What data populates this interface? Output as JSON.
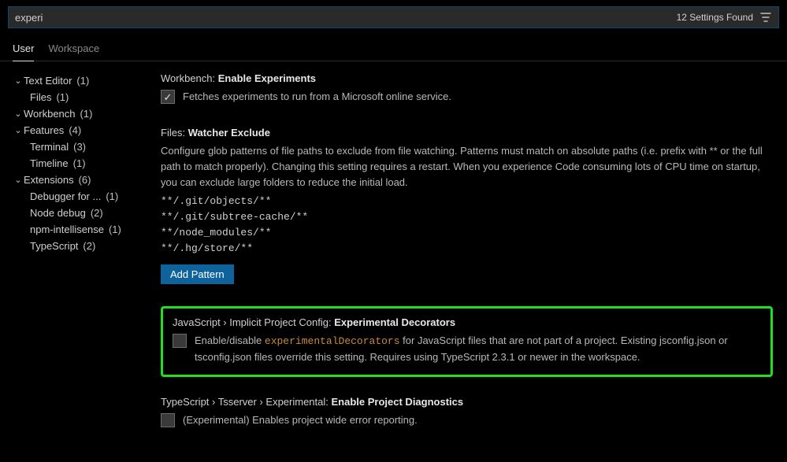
{
  "search": {
    "value": "experi",
    "status": "12 Settings Found"
  },
  "tabs": {
    "user": "User",
    "workspace": "Workspace"
  },
  "sidebar": {
    "items": [
      {
        "label": "Text Editor",
        "count": "(1)",
        "expanded": true,
        "children": [
          {
            "label": "Files",
            "count": "(1)"
          }
        ]
      },
      {
        "label": "Workbench",
        "count": "(1)",
        "expanded": true,
        "children": []
      },
      {
        "label": "Features",
        "count": "(4)",
        "expanded": true,
        "children": [
          {
            "label": "Terminal",
            "count": "(3)"
          },
          {
            "label": "Timeline",
            "count": "(1)"
          }
        ]
      },
      {
        "label": "Extensions",
        "count": "(6)",
        "expanded": true,
        "children": [
          {
            "label": "Debugger for ...",
            "count": "(1)"
          },
          {
            "label": "Node debug",
            "count": "(2)"
          },
          {
            "label": "npm-intellisense",
            "count": "(1)"
          },
          {
            "label": "TypeScript",
            "count": "(2)"
          }
        ]
      }
    ]
  },
  "settings": {
    "experiments": {
      "cat": "Workbench:",
      "name": "Enable Experiments",
      "desc": "Fetches experiments to run from a Microsoft online service.",
      "checked": true
    },
    "watcher": {
      "cat": "Files:",
      "name": "Watcher Exclude",
      "desc": "Configure glob patterns of file paths to exclude from file watching. Patterns must match on absolute paths (i.e. prefix with ** or the full path to match properly). Changing this setting requires a restart. When you experience Code consuming lots of CPU time on startup, you can exclude large folders to reduce the initial load.",
      "patterns": [
        "**/.git/objects/**",
        "**/.git/subtree-cache/**",
        "**/node_modules/**",
        "**/.hg/store/**"
      ],
      "add_label": "Add Pattern"
    },
    "decorators": {
      "cat": "JavaScript › Implicit Project Config:",
      "name": "Experimental Decorators",
      "desc_pre": "Enable/disable ",
      "code": "experimentalDecorators",
      "desc_post": " for JavaScript files that are not part of a project. Existing jsconfig.json or tsconfig.json files override this setting. Requires using TypeScript 2.3.1 or newer in the workspace.",
      "checked": false
    },
    "tsserver": {
      "cat": "TypeScript › Tsserver › Experimental:",
      "name": "Enable Project Diagnostics",
      "desc": "(Experimental) Enables project wide error reporting.",
      "checked": false
    }
  }
}
